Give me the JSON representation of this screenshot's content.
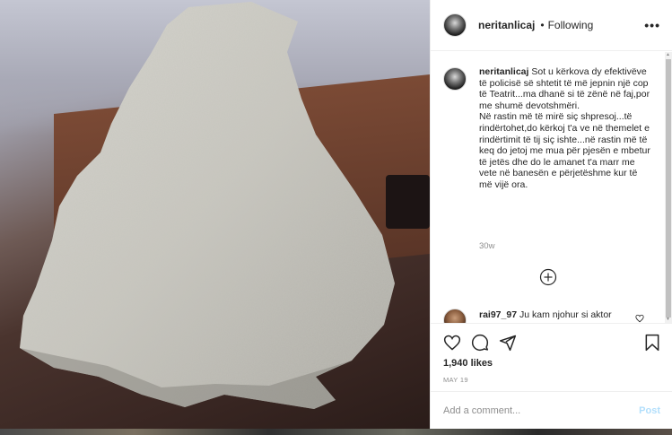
{
  "post": {
    "username": "neritanlicaj",
    "separator": "•",
    "follow_status": "Following",
    "more_label": "•••"
  },
  "caption": {
    "username": "neritanlicaj",
    "paragraph1": "Sot u kërkova dy efektivëve të policisë së shtetit të më jepnin një cop të Teatrit...ma dhanë si të zënë në faj,por me shumë devotshmëri.",
    "paragraph2": "Në rastin më të mirë siç shpresoj...të rindërtohet,do kërkoj t'a ve në themelet e rindërtimit të tij siç ishte...në rastin më të keq do jetoj me mua për pjesën e mbetur të jetës dhe do le amanet t'a marr me vete në banesën e përjetëshme kur të më vijë ora.",
    "time": "30w"
  },
  "reply": {
    "username": "rai97_97",
    "text": "Ju kam njohur si aktor"
  },
  "actions": {
    "likes": "1,940 likes",
    "date": "MAY 19"
  },
  "composer": {
    "placeholder": "Add a comment...",
    "post_label": "Post"
  },
  "colors": {
    "text": "#262626",
    "muted": "#8e8e8e",
    "post_disabled": "#b2dffc",
    "border": "#efefef"
  }
}
